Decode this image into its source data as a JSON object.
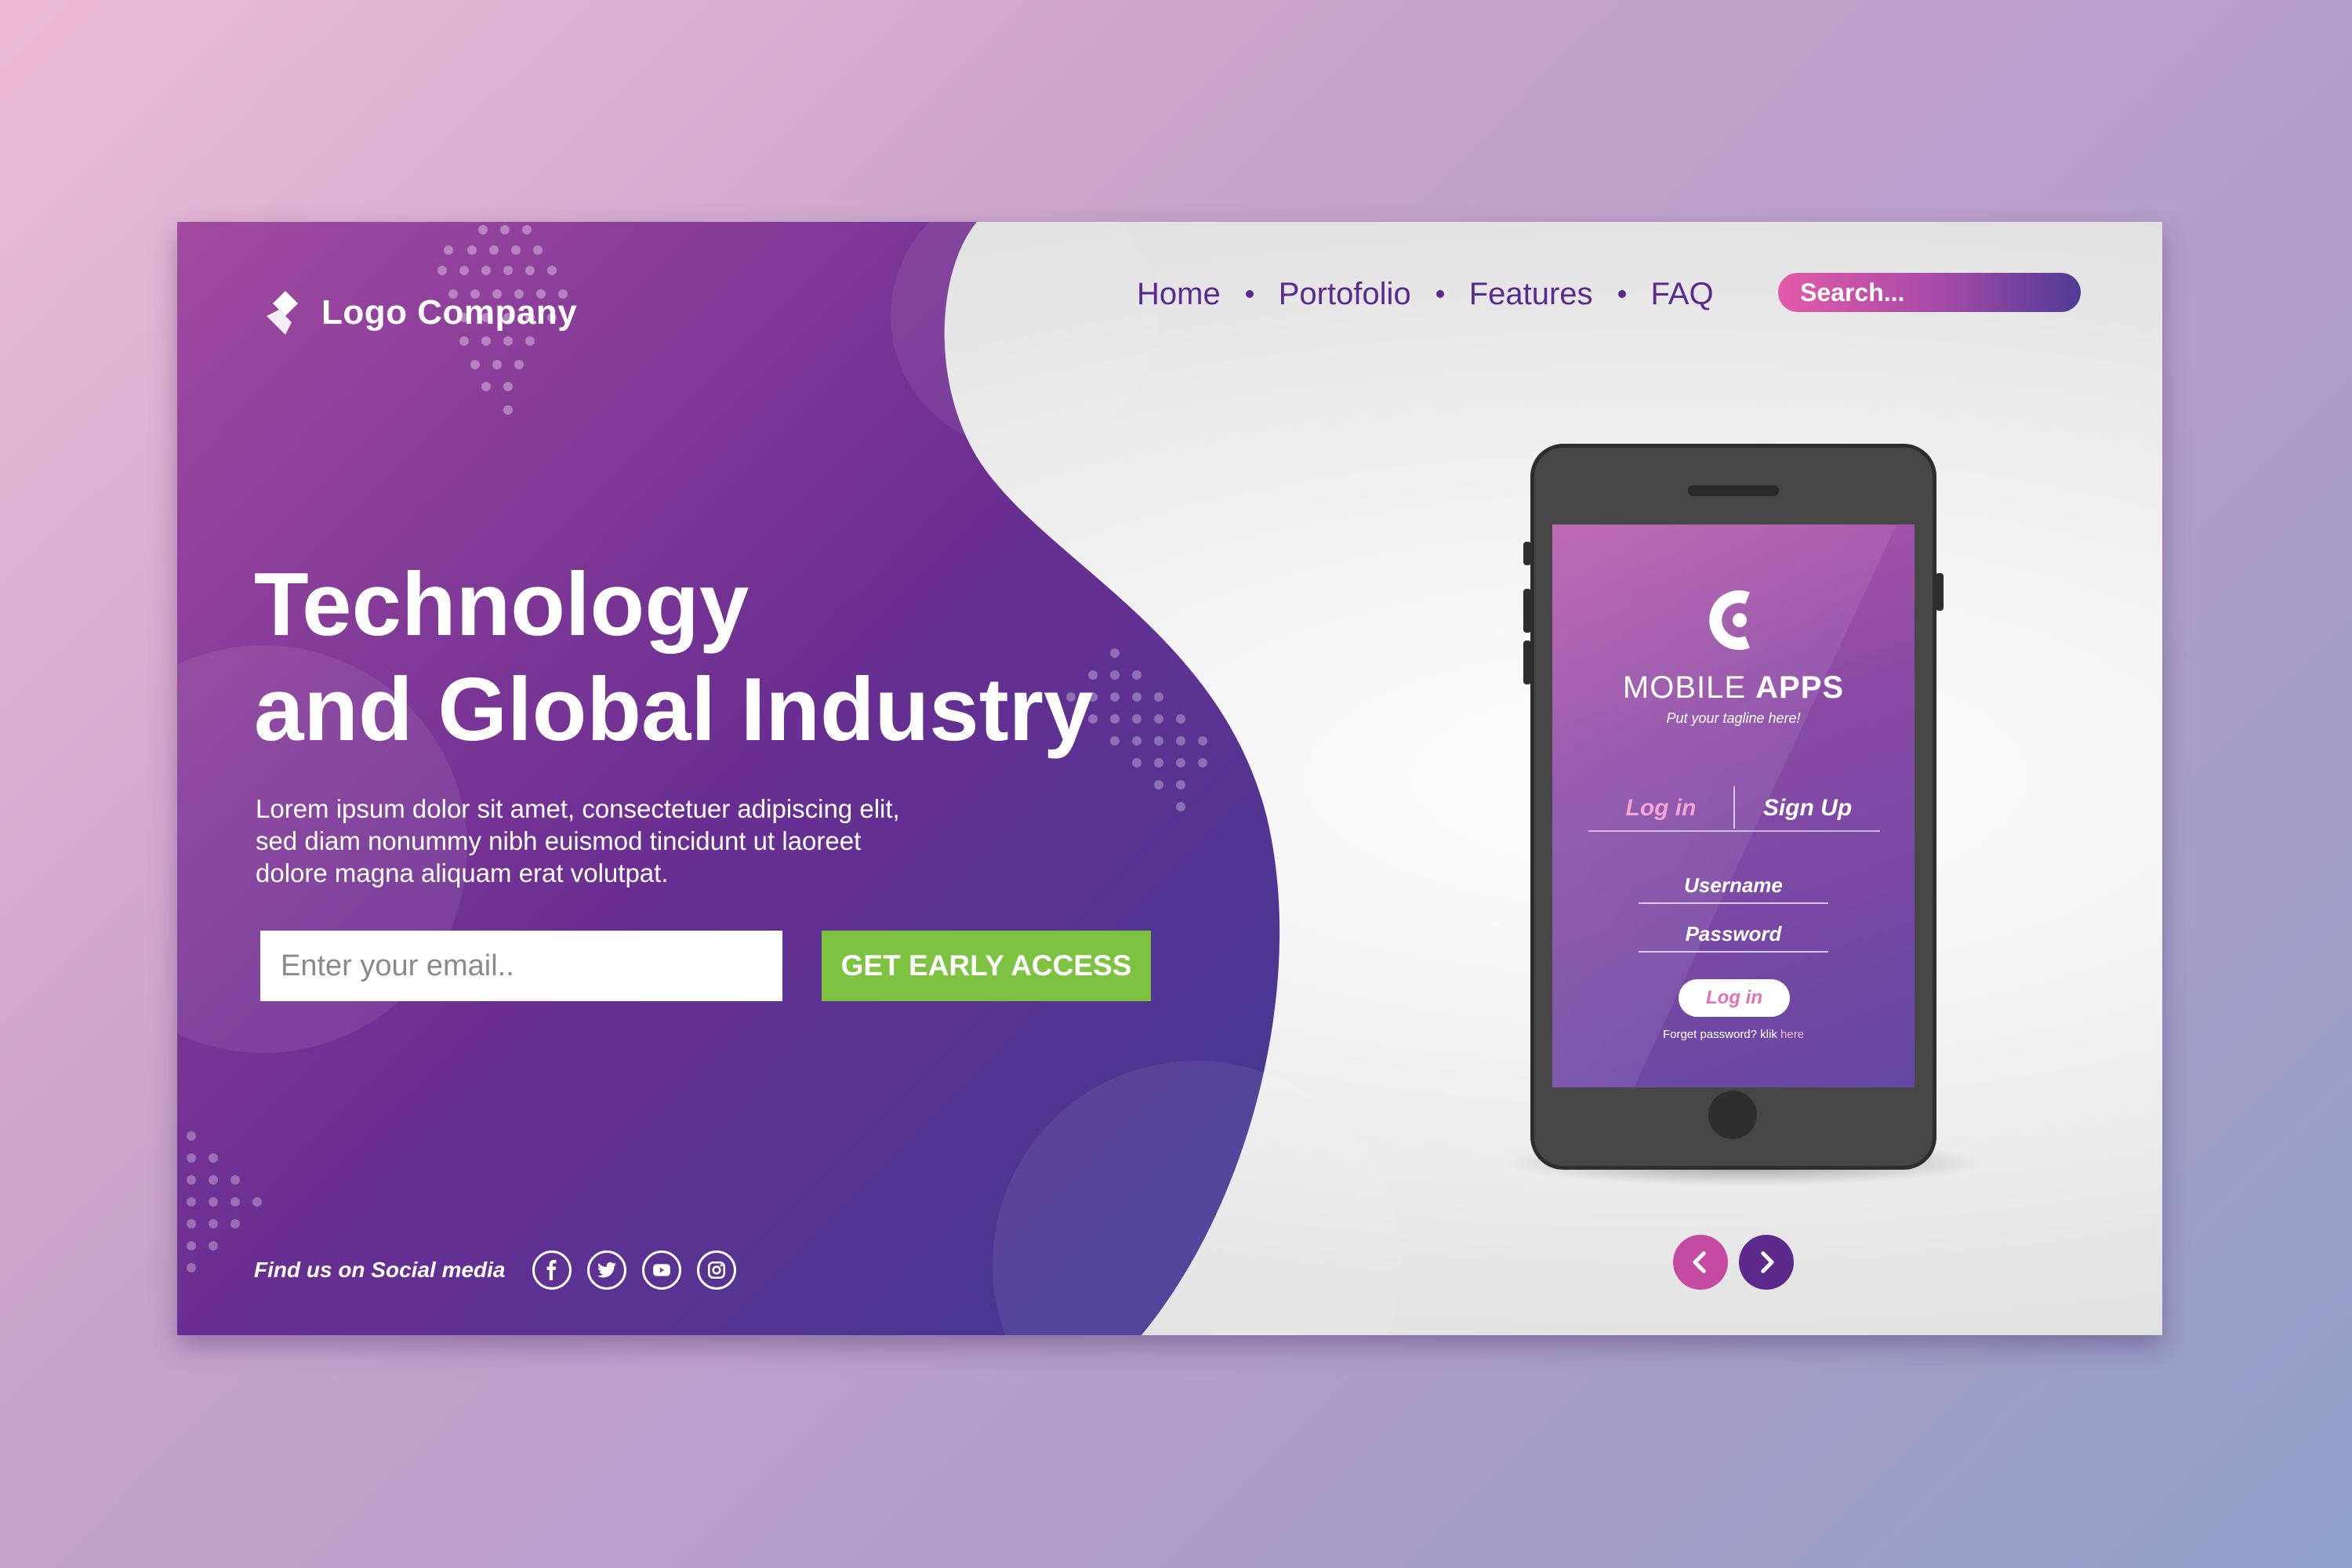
{
  "brand": {
    "name": "Logo Company"
  },
  "nav": {
    "items": [
      "Home",
      "Portofolio",
      "Features",
      "FAQ"
    ],
    "search_label": "Search..."
  },
  "hero": {
    "headline_line1": "Technology",
    "headline_line2": "and Global Industry",
    "subtext_line1": "Lorem ipsum dolor sit amet, consectetuer adipiscing elit,",
    "subtext_line2": "sed diam nonummy nibh euismod tincidunt ut laoreet",
    "subtext_line3": "dolore magna aliquam erat volutpat.",
    "email_placeholder": "Enter your email..",
    "cta_label": "GET EARLY ACCESS"
  },
  "social": {
    "label": "Find us on Social media",
    "icons": [
      "facebook-icon",
      "twitter-icon",
      "youtube-icon",
      "instagram-icon"
    ]
  },
  "phone_app": {
    "title_light": "MOBILE",
    "title_bold": "APPS",
    "tagline": "Put your tagline here!",
    "tab_login": "Log in",
    "tab_signup": "Sign Up",
    "username_label": "Username",
    "password_label": "Password",
    "login_button": "Log in",
    "forgot_text": "Forget password? klik",
    "forgot_link": "here"
  },
  "colors": {
    "purple_dark": "#5b2a8c",
    "magenta": "#c54aa2",
    "cta_green": "#7ec242",
    "search_gradient_start": "#e35aa8",
    "search_gradient_end": "#503b96"
  }
}
